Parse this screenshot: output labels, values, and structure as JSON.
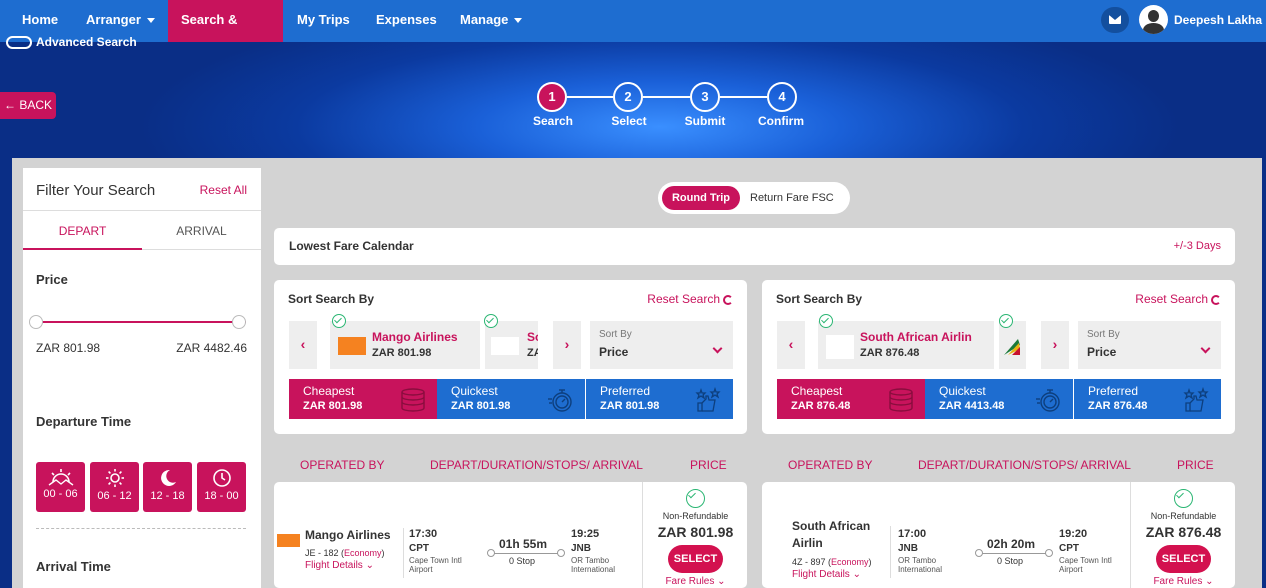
{
  "nav": {
    "items": [
      "Home",
      "Arranger",
      "Search & Book",
      "My Trips",
      "Expenses",
      "Manage"
    ],
    "user": "Deepesh Lakha"
  },
  "advanced_search": "Advanced Search",
  "back_label": "BACK",
  "steps": [
    {
      "num": "1",
      "label": "Search"
    },
    {
      "num": "2",
      "label": "Select"
    },
    {
      "num": "3",
      "label": "Submit"
    },
    {
      "num": "4",
      "label": "Confirm"
    }
  ],
  "filter": {
    "title": "Filter Your Search",
    "reset": "Reset All",
    "tabs": [
      "DEPART",
      "ARRIVAL"
    ],
    "price_label": "Price",
    "price_min": "ZAR 801.98",
    "price_max": "ZAR 4482.46",
    "departure_label": "Departure Time",
    "times": [
      "00 - 06",
      "06 - 12",
      "12 - 18",
      "18 - 00"
    ],
    "arrival_label": "Arrival Time"
  },
  "trip_toggle": {
    "active": "Round Trip",
    "other": "Return Fare FSC"
  },
  "lowest_fare": {
    "title": "Lowest Fare Calendar",
    "days": "+/-3 Days"
  },
  "sort_left": {
    "title": "Sort Search By",
    "reset": "Reset Search",
    "airline": "Mango Airlines",
    "airline_price": "ZAR 801.98",
    "next_airline": "So",
    "next_price": "ZA",
    "sortby_label": "Sort By",
    "sortby_value": "Price",
    "pills": [
      {
        "title": "Cheapest",
        "price": "ZAR 801.98"
      },
      {
        "title": "Quickest",
        "price": "ZAR 801.98"
      },
      {
        "title": "Preferred",
        "price": "ZAR 801.98"
      }
    ]
  },
  "sort_right": {
    "title": "Sort Search By",
    "reset": "Reset Search",
    "airline": "South African Airlin",
    "airline_price": "ZAR 876.48",
    "sortby_label": "Sort By",
    "sortby_value": "Price",
    "pills": [
      {
        "title": "Cheapest",
        "price": "ZAR 876.48"
      },
      {
        "title": "Quickest",
        "price": "ZAR 4413.48"
      },
      {
        "title": "Preferred",
        "price": "ZAR 876.48"
      }
    ]
  },
  "columns": {
    "operated": "OPERATED BY",
    "depart": "DEPART/DURATION/STOPS/ ARRIVAL",
    "price": "PRICE"
  },
  "result_left": {
    "airline": "Mango Airlines",
    "code": "JE - 182 (",
    "class": "Economy",
    "code_end": ")",
    "details": "Flight Details",
    "dep_time": "17:30",
    "dep_city": "CPT",
    "dep_airport": "Cape Town Intl Airport",
    "duration": "01h 55m",
    "stops": "0 Stop",
    "arr_time": "19:25",
    "arr_city": "JNB",
    "arr_airport": "OR Tambo International",
    "refund": "Non-Refundable",
    "price": "ZAR 801.98",
    "select": "SELECT",
    "rules": "Fare Rules"
  },
  "result_right": {
    "airline": "South African Airlin",
    "airline_line1": "South African",
    "airline_line2": "Airlin",
    "code": "4Z - 897 (",
    "class": "Economy",
    "code_end": ")",
    "details": "Flight Details",
    "dep_time": "17:00",
    "dep_city": "JNB",
    "dep_airport": "OR Tambo International",
    "duration": "02h 20m",
    "stops": "0 Stop",
    "arr_time": "19:20",
    "arr_city": "CPT",
    "arr_airport": "Cape Town Intl Airport",
    "refund": "Non-Refundable",
    "price": "ZAR 876.48",
    "select": "SELECT",
    "rules": "Fare Rules"
  },
  "colors": {
    "accent": "#c8135c",
    "nav": "#1e6dd0",
    "quick": "#1e6dd0",
    "check": "#2bb673"
  }
}
